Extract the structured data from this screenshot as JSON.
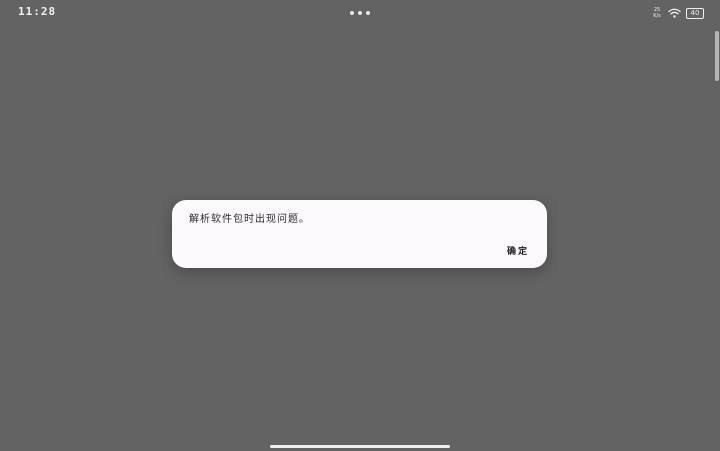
{
  "status_bar": {
    "time": "11:28",
    "net_speed": "25 K/s",
    "battery": "40"
  },
  "dialog": {
    "message": "解析软件包时出现问题。",
    "ok_label": "确定"
  },
  "colors": {
    "backdrop": "#636363",
    "dialog_bg": "#fcfafd"
  }
}
